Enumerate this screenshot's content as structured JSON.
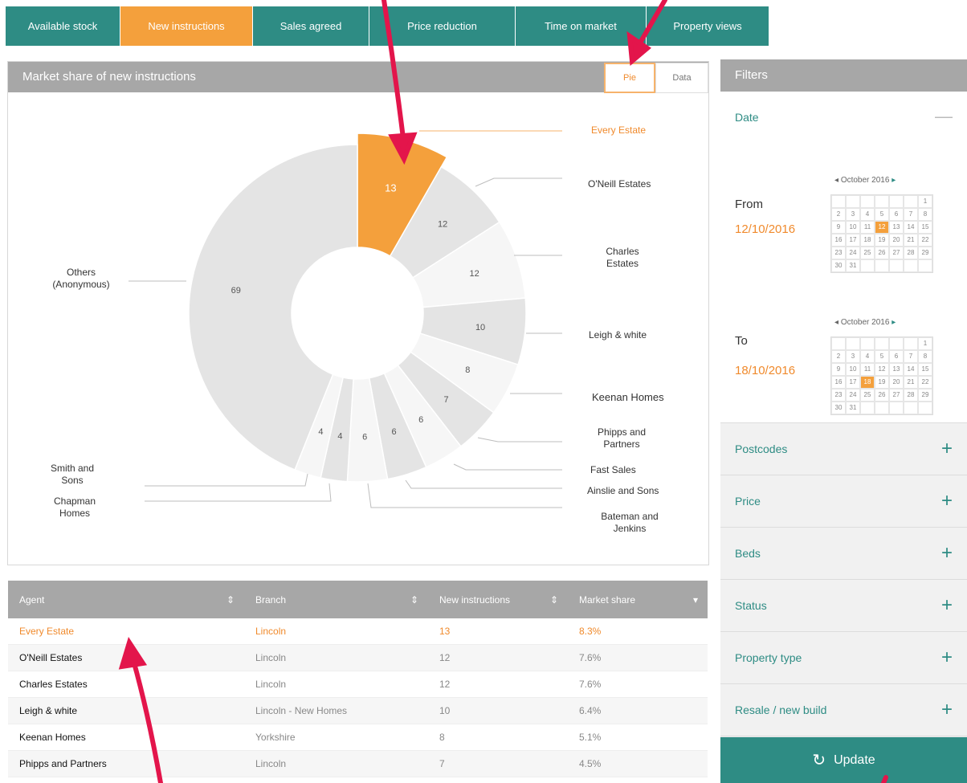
{
  "tabs": [
    "Available stock",
    "New instructions",
    "Sales agreed",
    "Price reduction",
    "Time on market",
    "Property views"
  ],
  "chart_panel": {
    "title": "Market share of new instructions",
    "toggle_pie": "Pie",
    "toggle_data": "Data"
  },
  "chart_data": {
    "type": "pie",
    "categories": [
      "Every Estate",
      "O'Neill Estates",
      "Charles Estates",
      "Leigh & white",
      "Keenan Homes",
      "Phipps and Partners",
      "Fast Sales",
      "Ainslie and Sons",
      "Bateman and Jenkins",
      "Chapman Homes",
      "Smith and Sons",
      "Others (Anonymous)"
    ],
    "values": [
      13,
      12,
      12,
      10,
      8,
      7,
      6,
      6,
      6,
      4,
      4,
      69
    ]
  },
  "table": {
    "headers": [
      "Agent",
      "Branch",
      "New instructions",
      "Market share"
    ],
    "rows": [
      [
        "Every Estate",
        "Lincoln",
        "13",
        "8.3%"
      ],
      [
        "O'Neill Estates",
        "Lincoln",
        "12",
        "7.6%"
      ],
      [
        "Charles Estates",
        "Lincoln",
        "12",
        "7.6%"
      ],
      [
        "Leigh & white",
        "Lincoln - New Homes",
        "10",
        "6.4%"
      ],
      [
        "Keenan Homes",
        "Yorkshire",
        "8",
        "5.1%"
      ],
      [
        "Phipps and Partners",
        "Lincoln",
        "7",
        "4.5%"
      ]
    ]
  },
  "filters": {
    "title": "Filters",
    "date_label": "Date",
    "from_label": "From",
    "from_value": "12/10/2016",
    "to_label": "To",
    "to_value": "18/10/2016",
    "cal_month": "October 2016",
    "sections": [
      "Postcodes",
      "Price",
      "Beds",
      "Status",
      "Property type",
      "Resale / new build"
    ]
  },
  "update_label": "Update",
  "colors": {
    "teal": "#2e8c84",
    "orange": "#f4a03c",
    "grey": "#a7a7a7",
    "arrow": "#e3154b"
  }
}
